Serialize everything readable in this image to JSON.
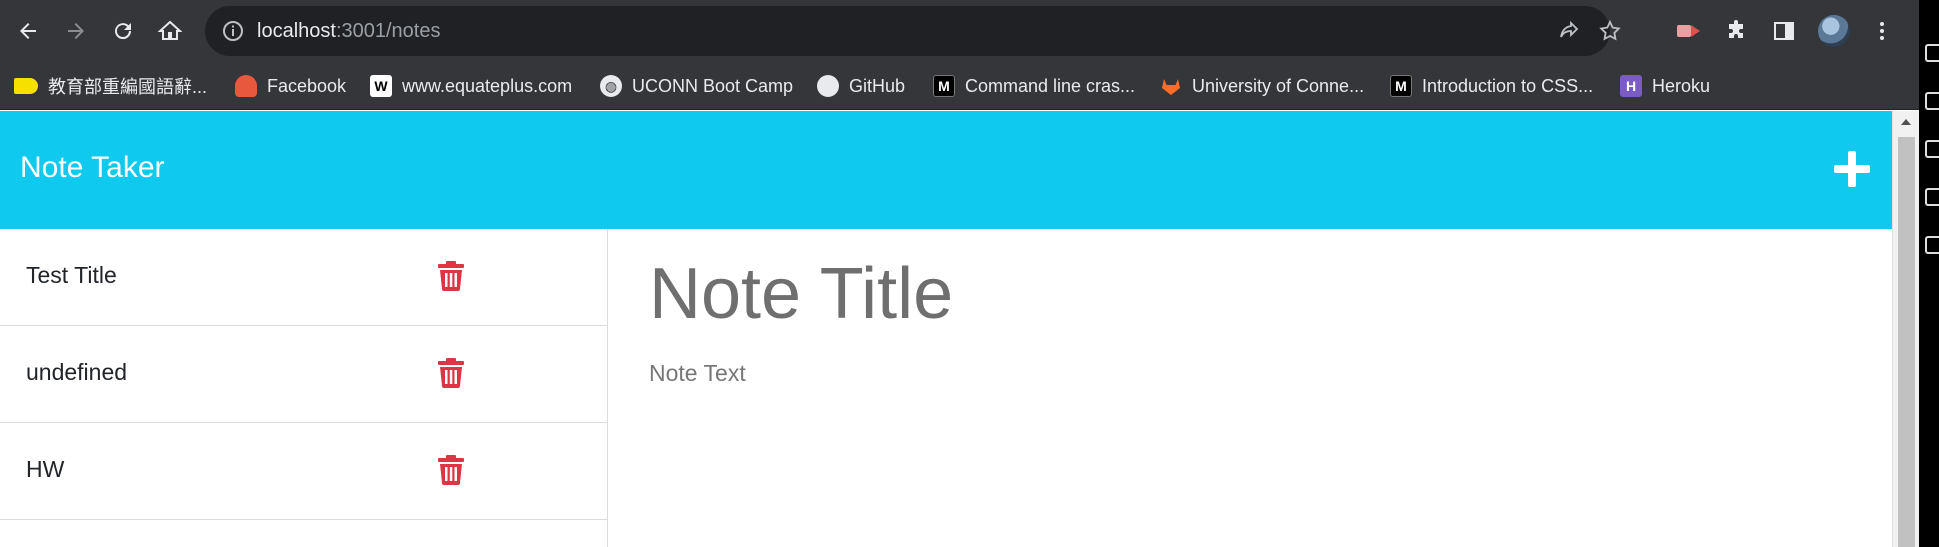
{
  "browser": {
    "url_host": "localhost",
    "url_path": ":3001/notes",
    "bookmarks": [
      {
        "label": "教育部重編國語辭...",
        "icon": "tag-icon",
        "color": "#f5e000"
      },
      {
        "label": "Facebook",
        "icon": "facebook-icon",
        "color": "#e8583f"
      },
      {
        "label": "www.equateplus.com",
        "icon": "wikipedia-icon",
        "color": "#ffffff"
      },
      {
        "label": "UCONN Boot Camp",
        "icon": "globe-icon",
        "color": "#e8eaed"
      },
      {
        "label": "GitHub",
        "icon": "github-icon",
        "color": "#e8eaed"
      },
      {
        "label": "Command line cras...",
        "icon": "mdn-icon",
        "color": "#000000"
      },
      {
        "label": "University of Conne...",
        "icon": "gitlab-icon",
        "color": "#fc6d26"
      },
      {
        "label": "Introduction to CSS...",
        "icon": "mdn-icon",
        "color": "#000000"
      },
      {
        "label": "Heroku",
        "icon": "heroku-icon",
        "color": "#7b5cc4"
      }
    ]
  },
  "app": {
    "brand": "Note Taker",
    "accent_color": "#10c9ef",
    "delete_color": "#dc3545",
    "notes": [
      {
        "title": "Test Title"
      },
      {
        "title": "undefined"
      },
      {
        "title": "HW"
      }
    ],
    "editor": {
      "title_placeholder": "Note Title",
      "text_placeholder": "Note Text"
    }
  }
}
